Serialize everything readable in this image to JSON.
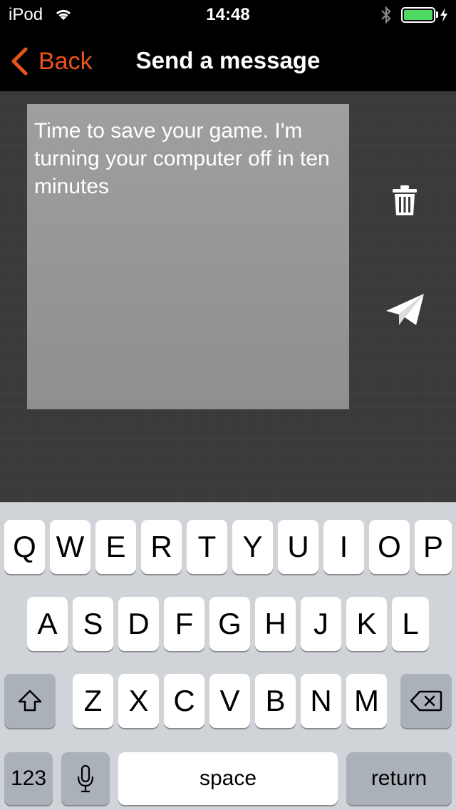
{
  "status_bar": {
    "carrier": "iPod",
    "time": "14:48",
    "battery_color": "#4cd964"
  },
  "nav": {
    "back_label": "Back",
    "title": "Send a message",
    "accent_color": "#e8541c"
  },
  "message": {
    "text": "Time to save your game. I'm turning your computer off in ten minutes"
  },
  "actions": {
    "delete_icon": "trash-icon",
    "send_icon": "paper-plane-icon"
  },
  "keyboard": {
    "row1": [
      "Q",
      "W",
      "E",
      "R",
      "T",
      "Y",
      "U",
      "I",
      "O",
      "P"
    ],
    "row2": [
      "A",
      "S",
      "D",
      "F",
      "G",
      "H",
      "J",
      "K",
      "L"
    ],
    "row3": [
      "Z",
      "X",
      "C",
      "V",
      "B",
      "N",
      "M"
    ],
    "numbers_label": "123",
    "space_label": "space",
    "return_label": "return",
    "shift_icon": "shift-icon",
    "delete_icon": "backspace-icon",
    "mic_icon": "microphone-icon"
  }
}
